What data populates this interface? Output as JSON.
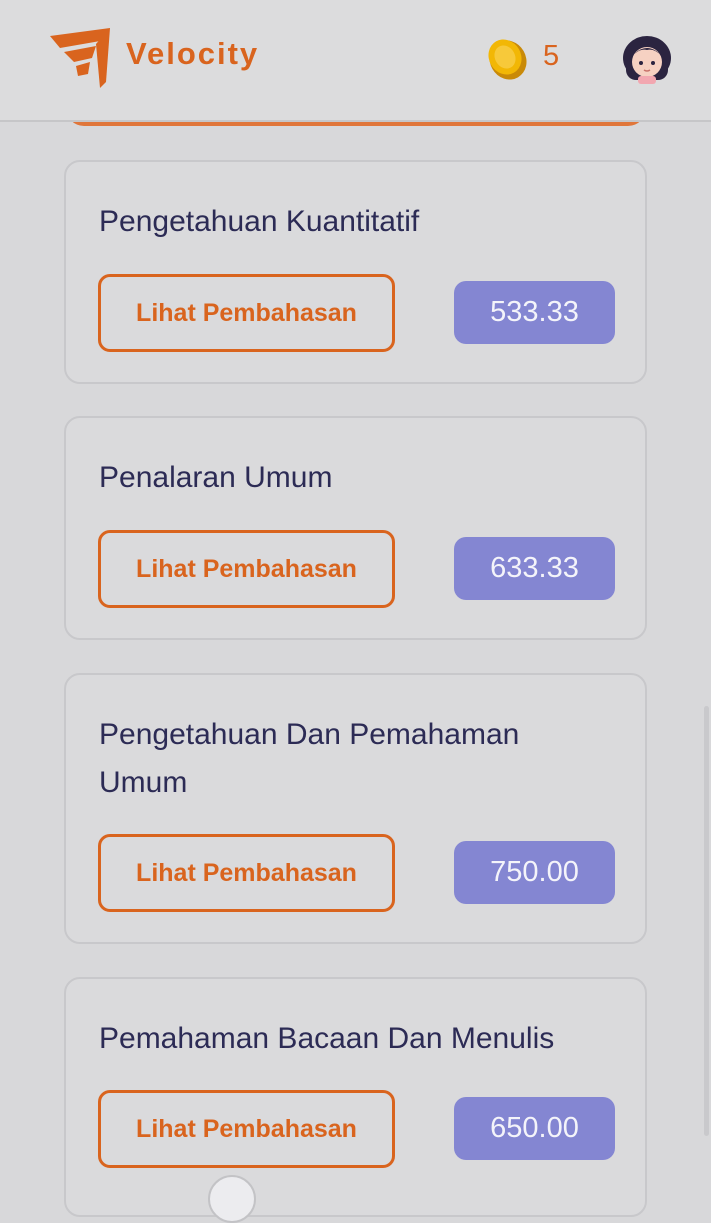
{
  "header": {
    "brand": "Velocity",
    "coins": "5",
    "accent_color": "#d9641e",
    "logo_icon": "velocity-logo-icon",
    "coin_icon": "coin-icon",
    "avatar_icon": "user-avatar-icon"
  },
  "review_label": "Lihat Pembahasan",
  "cards": [
    {
      "title": "Pengetahuan Kuantitatif",
      "button": "Lihat Pembahasan",
      "score": "533.33"
    },
    {
      "title": "Penalaran Umum",
      "button": "Lihat Pembahasan",
      "score": "633.33"
    },
    {
      "title": "Pengetahuan Dan Pemahaman Umum",
      "button": "Lihat Pembahasan",
      "score": "750.00"
    },
    {
      "title": "Pemahaman Bacaan Dan Menulis",
      "button": "Lihat Pembahasan",
      "score": "650.00"
    }
  ],
  "colors": {
    "button_border": "#d9641e",
    "score_badge": "#8486d2",
    "title_text": "#2c2b55",
    "background": "#d8d8da"
  }
}
